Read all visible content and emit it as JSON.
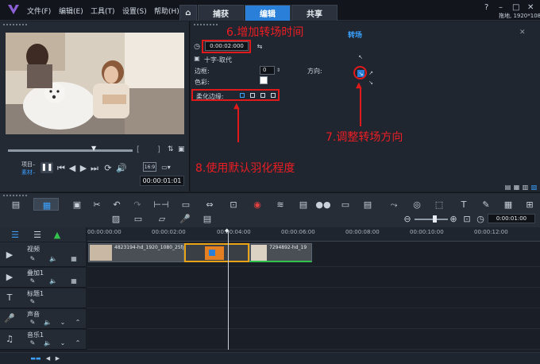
{
  "menu": [
    "文件(F)",
    "编辑(E)",
    "工具(T)",
    "设置(S)",
    "帮助(H)"
  ],
  "tabs": {
    "home": "⌂",
    "capture": "捕获",
    "edit": "编辑",
    "share": "共享"
  },
  "resolution": "拖地, 1920*1080",
  "preview": {
    "project_label": "项目–",
    "clip_label": "素材–",
    "timecode": "00:00:01:01",
    "aspect": "16:9"
  },
  "options": {
    "title": "转场",
    "duration": "0:00:02:000",
    "transition_name": "十字-取代",
    "border_label": "边框:",
    "border_value": "0",
    "direction_label": "方向:",
    "color_label": "色彩:",
    "soften_label": "柔化边缘:"
  },
  "annotations": {
    "a6": "6.增加转场时间",
    "a7": "7.调整转场方向",
    "a8": "8.使用默认羽化程度"
  },
  "timeline": {
    "zoom_timecode": "0:00:01:00",
    "ruler": [
      "00:00:00:00",
      "00:00:02:00",
      "00:00:04:00",
      "00:00:06:00",
      "00:00:08:00",
      "00:00:10:00",
      "00:00:12:00"
    ],
    "tracks": [
      "视频",
      "叠加1",
      "标题1",
      "声音",
      "音乐1"
    ],
    "clips": [
      "4823194-hd_1920_1080_25fps",
      "7294892-hd_19"
    ]
  },
  "colors": {
    "accent": "#2a7fd8",
    "annotation_red": "#e0191b"
  }
}
